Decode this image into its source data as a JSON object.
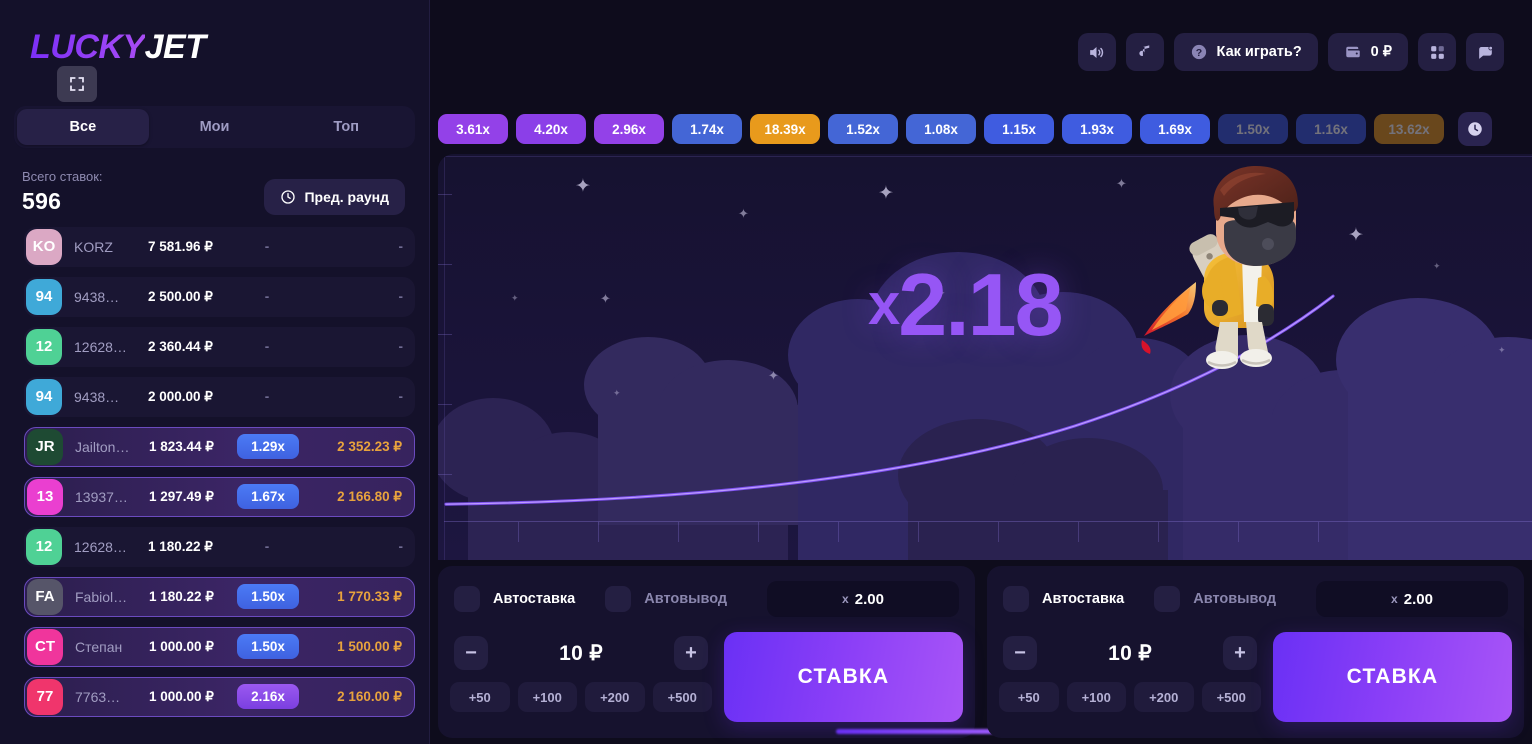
{
  "brand": {
    "name_part1": "LUCKY",
    "name_part2": "JET"
  },
  "sidebar": {
    "fullscreen_icon": "fullscreen-icon",
    "tabs": [
      {
        "label": "Все",
        "active": true
      },
      {
        "label": "Мои",
        "active": false
      },
      {
        "label": "Топ",
        "active": false
      }
    ],
    "stats": {
      "label": "Всего ставок:",
      "value": "596"
    },
    "prev_round_button": {
      "label": "Пред. раунд",
      "icon": "clock-icon"
    },
    "bets": [
      {
        "initials": "KO",
        "avatar_color": "#dba8c4",
        "name": "KORZ",
        "amount": "7 581.96 ₽",
        "mult": "-",
        "win": "-",
        "won": false
      },
      {
        "initials": "94",
        "avatar_color": "#3fa9d8",
        "name": "9438…",
        "amount": "2 500.00 ₽",
        "mult": "-",
        "win": "-",
        "won": false
      },
      {
        "initials": "12",
        "avatar_color": "#4fd195",
        "name": "12628…",
        "amount": "2 360.44 ₽",
        "mult": "-",
        "win": "-",
        "won": false
      },
      {
        "initials": "94",
        "avatar_color": "#3fa9d8",
        "name": "9438…",
        "amount": "2 000.00 ₽",
        "mult": "-",
        "win": "-",
        "won": false
      },
      {
        "initials": "JR",
        "avatar_color": "#1e4a33",
        "name": "Jailton…",
        "amount": "1 823.44 ₽",
        "mult": "1.29x",
        "win": "2 352.23 ₽",
        "won": true,
        "chip": "blue"
      },
      {
        "initials": "13",
        "avatar_color": "#ea3fd0",
        "name": "13937…",
        "amount": "1 297.49 ₽",
        "mult": "1.67x",
        "win": "2 166.80 ₽",
        "won": true,
        "chip": "blue"
      },
      {
        "initials": "12",
        "avatar_color": "#4fd195",
        "name": "12628…",
        "amount": "1 180.22 ₽",
        "mult": "-",
        "win": "-",
        "won": false
      },
      {
        "initials": "FA",
        "avatar_color": "#565569",
        "name": "Fabiol…",
        "amount": "1 180.22 ₽",
        "mult": "1.50x",
        "win": "1 770.33 ₽",
        "won": true,
        "chip": "blue"
      },
      {
        "initials": "CT",
        "avatar_color": "#f0359c",
        "name": "Степан",
        "amount": "1 000.00 ₽",
        "mult": "1.50x",
        "win": "1 500.00 ₽",
        "won": true,
        "chip": "blue"
      },
      {
        "initials": "77",
        "avatar_color": "#f0356c",
        "name": "7763…",
        "amount": "1 000.00 ₽",
        "mult": "2.16x",
        "win": "2 160.00 ₽",
        "won": true,
        "chip": "purple"
      }
    ]
  },
  "topbar": {
    "sound_icon": "speaker-icon",
    "music_icon": "music-note-icon",
    "how_to_play": {
      "label": "Как играть?",
      "icon": "question-mark-icon"
    },
    "wallet": {
      "icon": "wallet-icon",
      "balance": "0 ₽"
    },
    "grid_icon": "grid-icon",
    "chat_icon": "chat-icon"
  },
  "history": {
    "clock_icon": "clock-icon",
    "items": [
      {
        "value": "3.61x",
        "color": "#9341e8",
        "faded": false
      },
      {
        "value": "4.20x",
        "color": "#8b3fe8",
        "faded": false
      },
      {
        "value": "2.96x",
        "color": "#9341e8",
        "faded": false
      },
      {
        "value": "1.74x",
        "color": "#4466d6",
        "faded": false
      },
      {
        "value": "18.39x",
        "color": "#e89a1c",
        "faded": false
      },
      {
        "value": "1.52x",
        "color": "#4466d6",
        "faded": false
      },
      {
        "value": "1.08x",
        "color": "#4466d6",
        "faded": false
      },
      {
        "value": "1.15x",
        "color": "#3f5ce0",
        "faded": false
      },
      {
        "value": "1.93x",
        "color": "#3f5ce0",
        "faded": false
      },
      {
        "value": "1.69x",
        "color": "#3f5ce0",
        "faded": false
      },
      {
        "value": "1.50x",
        "color": "#3f5ce0",
        "faded": true
      },
      {
        "value": "1.16x",
        "color": "#3f5ce0",
        "faded": true
      },
      {
        "value": "13.62x",
        "color": "#e89a1c",
        "faded": true
      }
    ]
  },
  "game": {
    "multiplier": "2.18",
    "multiplier_prefix": "x",
    "character": "jetpack-pilot"
  },
  "bet_panels": [
    {
      "autobet_label": "Автоставка",
      "autocashout_label": "Автовывод",
      "auto_value_prefix": "x",
      "auto_value": "2.00",
      "stake": "10 ₽",
      "minus": "−",
      "plus": "+",
      "quick_adds": [
        "+50",
        "+100",
        "+200",
        "+500"
      ],
      "bet_button": "СТАВКА"
    },
    {
      "autobet_label": "Автоставка",
      "autocashout_label": "Автовывод",
      "auto_value_prefix": "x",
      "auto_value": "2.00",
      "stake": "10 ₽",
      "minus": "−",
      "plus": "+",
      "quick_adds": [
        "+50",
        "+100",
        "+200",
        "+500"
      ],
      "bet_button": "СТАВКА"
    }
  ],
  "colors": {
    "accent": "#8b3ff7",
    "win_gold": "#e8a33d",
    "panel_bg": "#16122e",
    "sidebar_bg": "#14112a"
  }
}
